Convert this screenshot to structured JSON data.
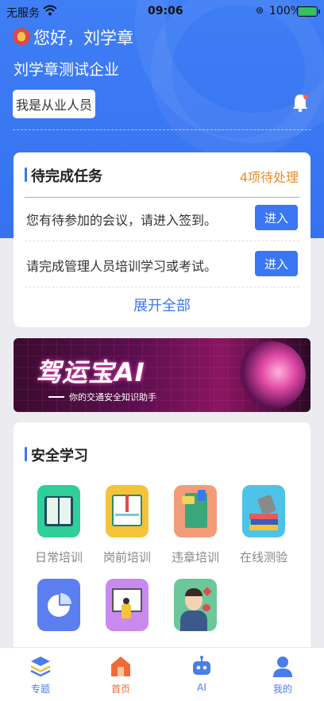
{
  "status_bar": {
    "carrier": "无服务",
    "time": "09:06",
    "battery_percent": "100%"
  },
  "header": {
    "greeting": "您好，刘学章",
    "company": "刘学章测试企业",
    "role_button": "我是从业人员"
  },
  "tasks": {
    "title": "待完成任务",
    "pending_count": "4项待处理",
    "items": [
      {
        "text": "您有待参加的会议，请进入签到。",
        "button": "进入"
      },
      {
        "text": "请完成管理人员培训学习或考试。",
        "button": "进入"
      }
    ],
    "expand_label": "展开全部"
  },
  "banner": {
    "title": "驾运宝AI",
    "subtitle": "你的交通安全知识助手"
  },
  "study": {
    "title": "安全学习",
    "items": [
      {
        "label": "日常培训",
        "icon": "book-icon",
        "color": "#2ecf9a"
      },
      {
        "label": "岗前培训",
        "icon": "open-book-icon",
        "color": "#f4c33a"
      },
      {
        "label": "违章培训",
        "icon": "folder-icon",
        "color": "#f29c7a"
      },
      {
        "label": "在线测验",
        "icon": "books-stack-icon",
        "color": "#4ec3e8"
      },
      {
        "label": "",
        "icon": "pie-chart-icon",
        "color": "#5b7ff0"
      },
      {
        "label": "",
        "icon": "presentation-icon",
        "color": "#c98af0"
      },
      {
        "label": "",
        "icon": "health-person-icon",
        "color": "#6cc79a"
      }
    ]
  },
  "tabbar": {
    "items": [
      {
        "label": "专题",
        "icon": "layers-icon"
      },
      {
        "label": "首页",
        "icon": "home-icon"
      },
      {
        "label": "AI",
        "icon": "robot-icon"
      },
      {
        "label": "我的",
        "icon": "user-icon"
      }
    ],
    "active": "首页"
  },
  "colors": {
    "primary": "#3b77f2",
    "pending": "#f08a2b",
    "active_tab": "#f06a3a"
  }
}
